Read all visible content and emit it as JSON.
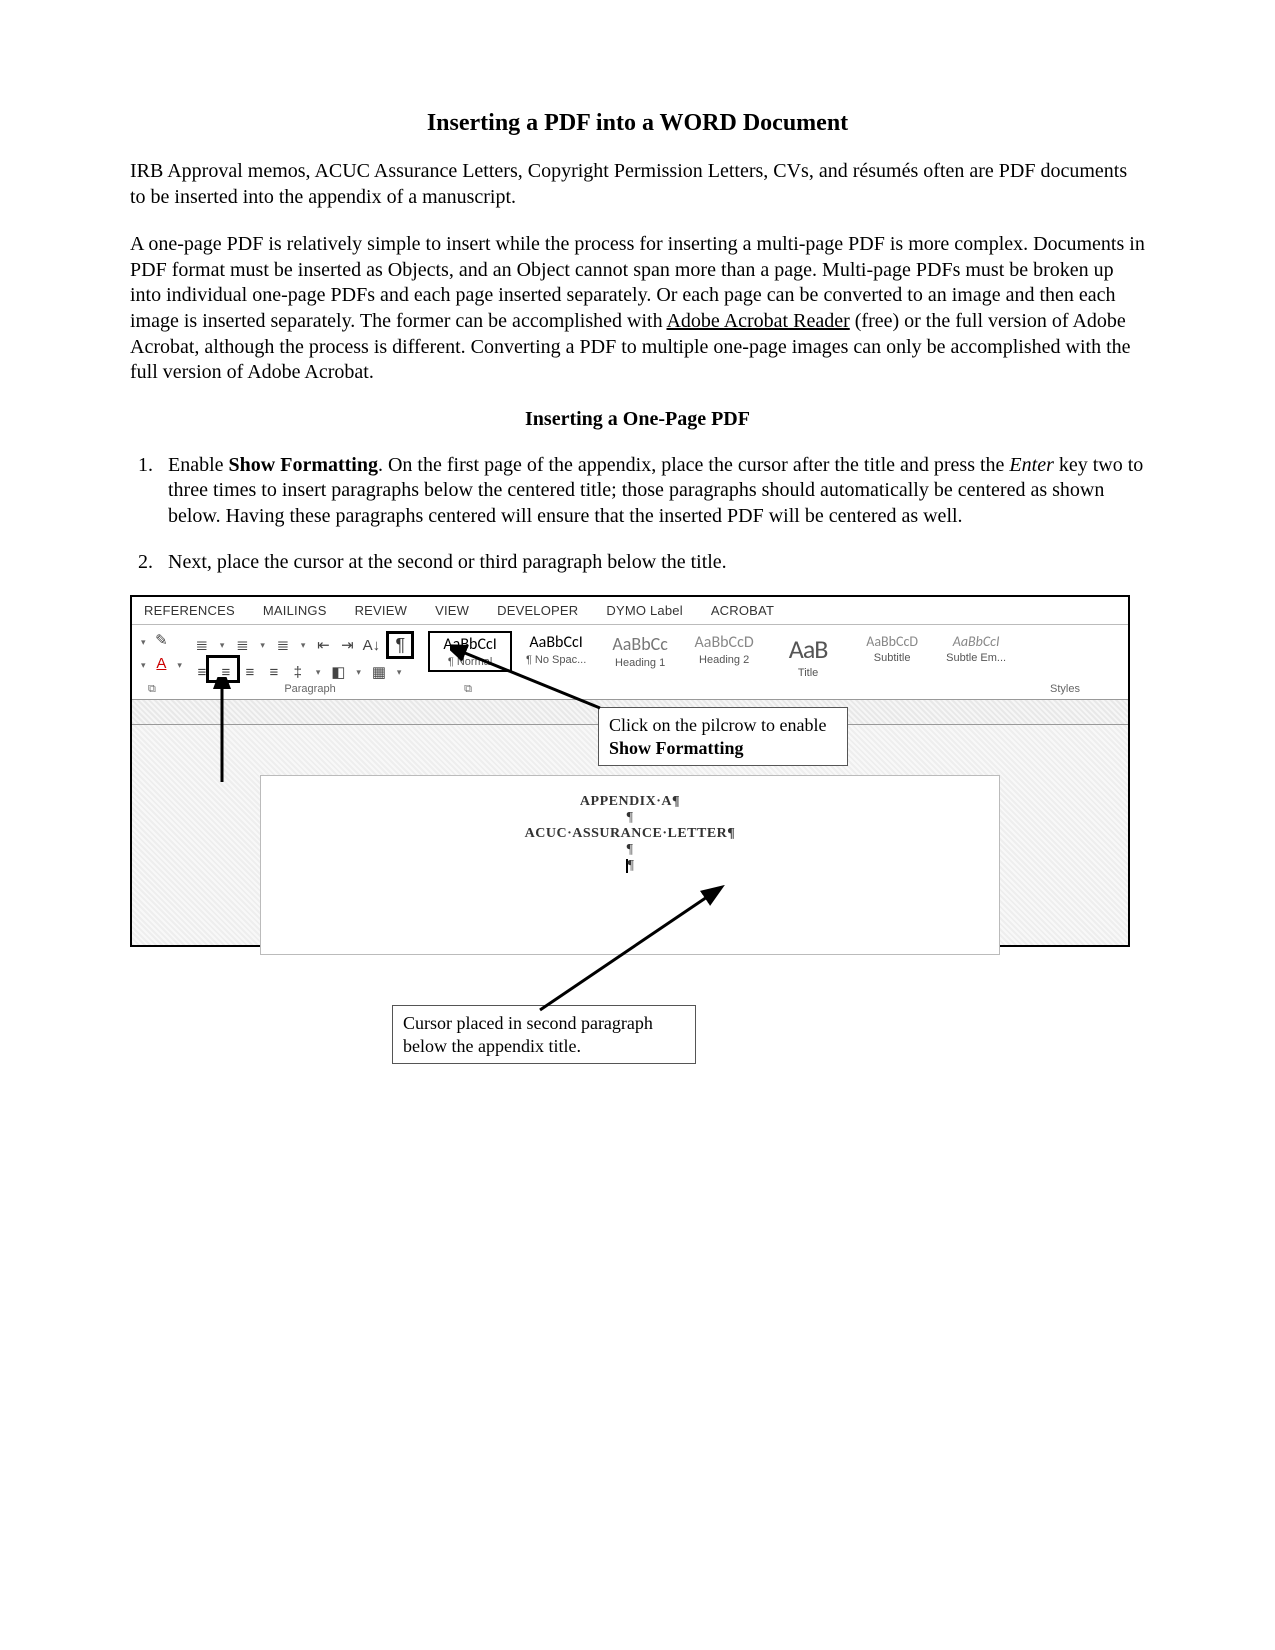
{
  "title": "Inserting a PDF into a WORD Document",
  "intro_p1": "IRB Approval memos, ACUC Assurance Letters, Copyright Permission Letters, CVs, and résumés often are PDF documents to be inserted into the appendix of a manuscript.",
  "intro_p2a": "A one-page PDF is relatively simple to insert while the process for inserting a multi-page PDF is more complex. Documents in PDF format must be inserted as Objects, and an Object cannot span more than a page. Multi-page PDFs must be broken up into individual one-page PDFs and each page inserted separately. Or each page can be converted to an image and then each image is inserted separately. The former can be accomplished with ",
  "intro_p2_link": "Adobe Acrobat Reader",
  "intro_p2b": " (free) or the full version of Adobe Acrobat, although the process is different. Converting a PDF to multiple one-page images can only be accomplished with the full version of Adobe Acrobat.",
  "subhead": "Inserting a One-Page PDF",
  "step1_a": "Enable ",
  "step1_bold": "Show Formatting",
  "step1_b": ". On the first page of the appendix, place the cursor after the title and press the ",
  "step1_ital": "Enter",
  "step1_c": " key two to three times to insert paragraphs below the centered title; those paragraphs should automatically be centered as shown below. Having these paragraphs centered will ensure that the inserted PDF will be centered as well.",
  "step2": "Next, place the cursor at the second or third paragraph below the title.",
  "ribbon": {
    "tabs": [
      "REFERENCES",
      "MAILINGS",
      "REVIEW",
      "VIEW",
      "DEVELOPER",
      "DYMO Label",
      "ACROBAT"
    ],
    "group_paragraph": "Paragraph",
    "group_styles": "Styles",
    "styles": {
      "normal": {
        "preview": "AaBbCcI",
        "label": "¶ Normal"
      },
      "nospac": {
        "preview": "AaBbCcI",
        "label": "¶ No Spac..."
      },
      "h1": {
        "preview": "AaBbCc",
        "label": "Heading 1"
      },
      "h2": {
        "preview": "AaBbCcD",
        "label": "Heading 2"
      },
      "title": {
        "preview": "AaB",
        "label": "Title"
      },
      "subtitle": {
        "preview": "AaBbCcD",
        "label": "Subtitle"
      },
      "subtleem": {
        "preview": "AaBbCcI",
        "label": "Subtle Em..."
      }
    }
  },
  "doc": {
    "line1": "APPENDIX·A¶",
    "pil": "¶",
    "line2": "ACUC·ASSURANCE·LETTER¶"
  },
  "callouts": {
    "pilcrow_a": "Click on the pilcrow to enable ",
    "pilcrow_b": "Show Formatting",
    "cursor": "Cursor placed in second paragraph below the appendix title."
  }
}
